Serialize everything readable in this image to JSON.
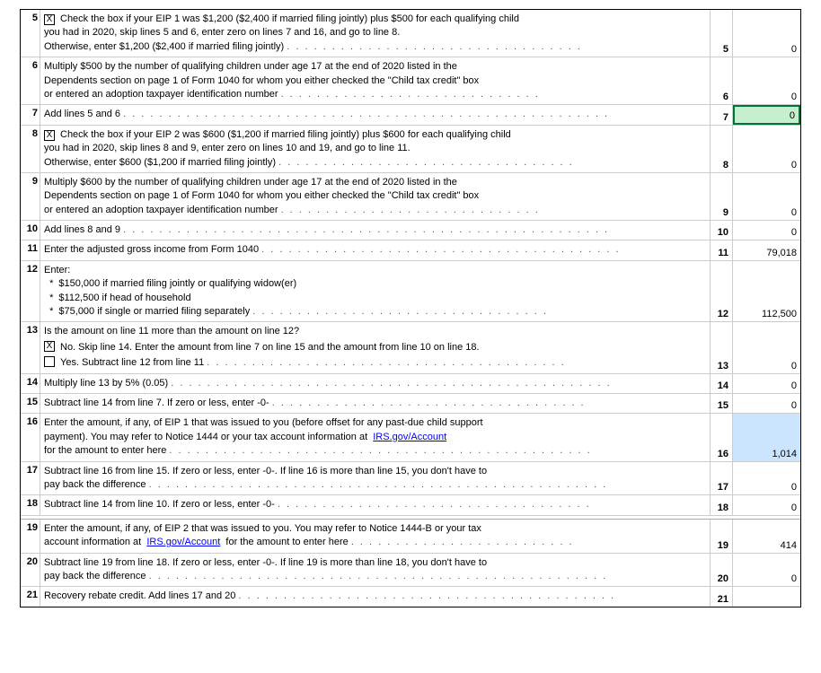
{
  "form": {
    "lines": [
      {
        "num": "5",
        "checkbox": true,
        "checked": true,
        "content_parts": [
          "Check the box if your EIP 1 was $1,200 ($2,400 if married filing jointly) plus $500 for each qualifying child",
          "you had in 2020, skip lines 5 and 6, enter zero on lines 7 and 16, and go to line 8.",
          "Otherwise, enter $1,200 ($2,400 if married filing jointly)"
        ],
        "line_ref": "5",
        "value": "0",
        "highlight": false
      },
      {
        "num": "6",
        "checkbox": false,
        "content_parts": [
          "Multiply $500 by the number of qualifying children under age 17 at the end of 2020 listed in the",
          "Dependents section on page 1 of Form 1040 for whom you either checked the \"Child tax credit\" box",
          "or entered an adoption taxpayer identification number"
        ],
        "line_ref": "6",
        "value": "0",
        "highlight": false
      },
      {
        "num": "7",
        "checkbox": false,
        "content_parts": [
          "Add lines 5 and 6"
        ],
        "line_ref": "7",
        "value": "0",
        "highlight": true
      },
      {
        "num": "8",
        "checkbox": true,
        "checked": true,
        "content_parts": [
          "Check the box if your EIP 2 was $600 ($1,200 if married filing jointly) plus $600 for each qualifying child",
          "you had in 2020, skip lines 8 and 9, enter zero on lines 10 and 19, and go to line 11.",
          "Otherwise, enter $600 ($1,200 if married filing jointly)"
        ],
        "line_ref": "8",
        "value": "0",
        "highlight": false
      },
      {
        "num": "9",
        "checkbox": false,
        "content_parts": [
          "Multiply $600 by the number of qualifying children under age 17 at the end of 2020 listed in the",
          "Dependents section on page 1 of Form 1040 for whom you either checked the \"Child tax credit\" box",
          "or entered an adoption taxpayer identification number"
        ],
        "line_ref": "9",
        "value": "0",
        "highlight": false
      },
      {
        "num": "10",
        "content_parts": [
          "Add lines 8 and 9"
        ],
        "line_ref": "10",
        "value": "0",
        "highlight": false
      },
      {
        "num": "11",
        "content_parts": [
          "Enter the adjusted gross income from Form 1040"
        ],
        "line_ref": "11",
        "value": "79,018",
        "highlight": false
      },
      {
        "num": "12",
        "is_enter": true,
        "enter_label": "Enter:",
        "bullets": [
          "$150,000 if married filing jointly or qualifying widow(er)",
          "$112,500 if head of household",
          "$75,000 if single or married filing separately"
        ],
        "line_ref": "12",
        "value": "112,500",
        "highlight": false
      },
      {
        "num": "13",
        "is_question": true,
        "question": "Is the amount on line 11 more than the amount on line 12?",
        "options": [
          {
            "checked": true,
            "label": "No. Skip line 14. Enter the amount from line 7 on line 15 and the amount from line 10 on line 18."
          },
          {
            "checked": false,
            "label": "Yes. Subtract line 12 from line 11"
          }
        ],
        "line_ref": "13",
        "value": "0",
        "highlight": false
      },
      {
        "num": "14",
        "content_parts": [
          "Multiply line 13 by 5% (0.05)"
        ],
        "line_ref": "14",
        "value": "0",
        "highlight": false
      },
      {
        "num": "15",
        "content_parts": [
          "Subtract line 14 from line 7. If zero or less, enter -0-"
        ],
        "line_ref": "15",
        "value": "0",
        "highlight": false
      },
      {
        "num": "16",
        "is_long": true,
        "content_parts": [
          "Enter the amount, if any, of EIP 1 that was issued to you (before offset for any past-due child support",
          "payment). You may refer to Notice 1444 or your tax account information at"
        ],
        "link": "IRS.gov/Account",
        "content_after": "for the amount to enter here",
        "line_ref": "16",
        "value": "1,014",
        "highlight": false,
        "blue": true
      },
      {
        "num": "17",
        "content_parts": [
          "Subtract line 16 from line 15. If zero or less, enter -0-. If line 16 is more than line 15, you don't have to",
          "pay back the difference"
        ],
        "line_ref": "17",
        "value": "0",
        "highlight": false
      },
      {
        "num": "18",
        "content_parts": [
          "Subtract line 14 from line 10. If zero or less, enter -0-"
        ],
        "line_ref": "18",
        "value": "0",
        "highlight": false
      },
      {
        "num": "19",
        "is_long2": true,
        "content_parts": [
          "Enter the amount, if any, of EIP 2 that was issued to you. You may refer to Notice 1444-B or your tax",
          "account information at"
        ],
        "link": "IRS.gov/Account",
        "content_after": "for the amount to enter here",
        "line_ref": "19",
        "value": "414",
        "highlight": false
      },
      {
        "num": "20",
        "content_parts": [
          "Subtract line 19 from line 18. If zero or less, enter -0-. If line 19 is more than line 18, you don't have to",
          "pay back the difference"
        ],
        "line_ref": "20",
        "value": "0",
        "highlight": false
      },
      {
        "num": "21",
        "content_parts": [
          "Recovery rebate credit. Add lines 17 and 20"
        ],
        "line_ref": "21",
        "value": "",
        "highlight": false
      }
    ]
  }
}
